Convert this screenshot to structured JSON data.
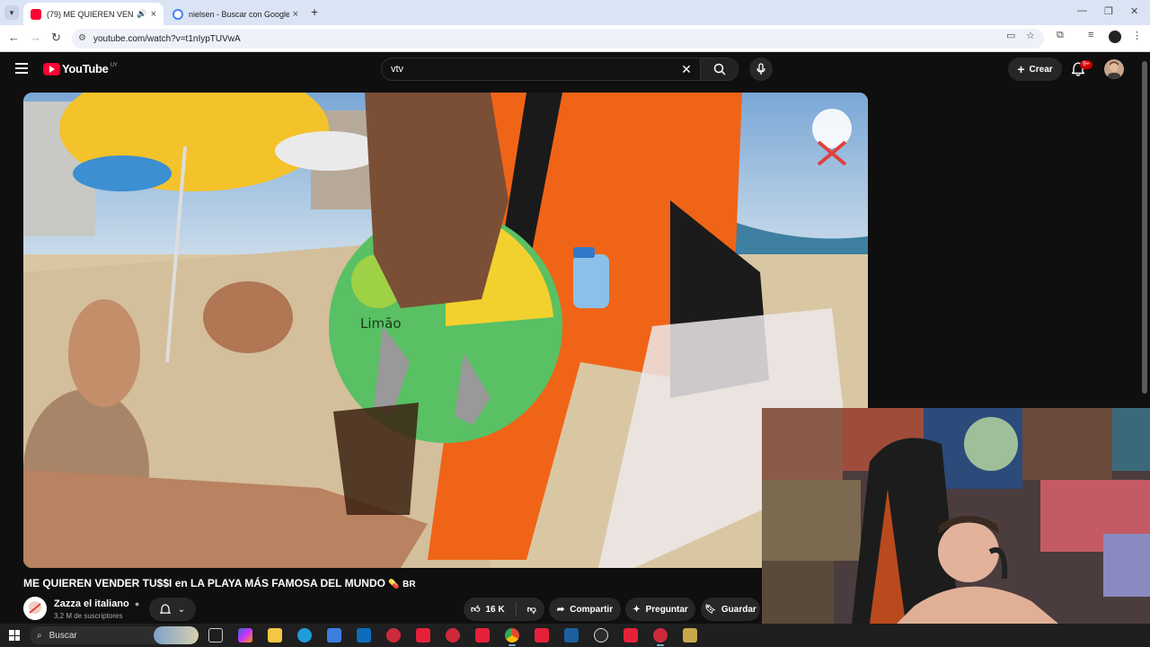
{
  "browser": {
    "tabs": [
      {
        "title": "(79) ME QUIEREN VENDER",
        "favicon_color": "#ff0033",
        "active": true
      },
      {
        "title": "nielsen - Buscar con Google",
        "favicon_color": "#4285f4",
        "active": false
      }
    ],
    "new_tab": "+",
    "url": "youtube.com/watch?v=t1nIypTUVwA"
  },
  "youtube": {
    "logo_text": "YouTube",
    "country_code": "UY",
    "search_query": "vtv",
    "create_label": "Crear",
    "notif_badge": "9+"
  },
  "video": {
    "title": "ME QUIEREN VENDER TU$$I en LA PLAYA MÁS FAMOSA DEL MUNDO",
    "title_suffix": "BR",
    "dispenser_label": "Limão",
    "channel_name": "Zazza el italiano",
    "subscribers": "3,2 M de suscriptores",
    "likes": "16 K",
    "share_label": "Compartir",
    "ask_label": "Preguntar",
    "save_label": "Guardar"
  },
  "taskbar": {
    "search_label": "Buscar"
  },
  "colors": {
    "yt_red": "#ff0033",
    "background": "#0f0f0f",
    "pill": "#272727"
  }
}
